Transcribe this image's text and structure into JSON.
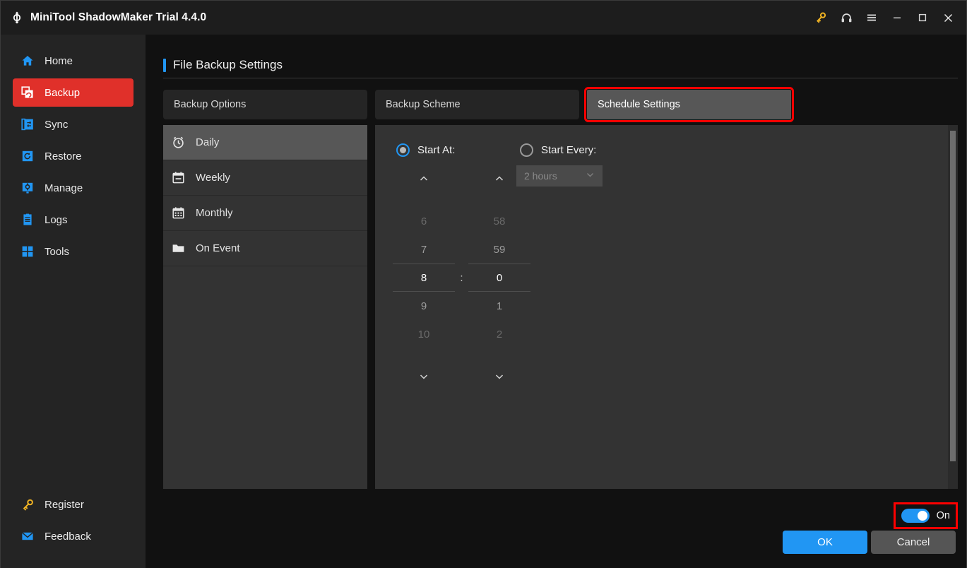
{
  "window": {
    "title": "MiniTool ShadowMaker Trial 4.4.0",
    "logo_icon": "shadowmaker-logo-icon",
    "controls": [
      {
        "name": "key-icon",
        "label": "⚷"
      },
      {
        "name": "headset-icon",
        "label": "☎"
      },
      {
        "name": "menu-icon",
        "label": "☰"
      },
      {
        "name": "minimize-icon",
        "label": "–"
      },
      {
        "name": "maximize-icon",
        "label": "□"
      },
      {
        "name": "close-icon",
        "label": "✕"
      }
    ]
  },
  "sidebar": {
    "items": [
      {
        "label": "Home",
        "icon": "home-icon",
        "active": false
      },
      {
        "label": "Backup",
        "icon": "backup-icon",
        "active": true
      },
      {
        "label": "Sync",
        "icon": "sync-icon",
        "active": false
      },
      {
        "label": "Restore",
        "icon": "restore-icon",
        "active": false
      },
      {
        "label": "Manage",
        "icon": "manage-icon",
        "active": false
      },
      {
        "label": "Logs",
        "icon": "logs-icon",
        "active": false
      },
      {
        "label": "Tools",
        "icon": "tools-icon",
        "active": false
      }
    ],
    "bottom_items": [
      {
        "label": "Register",
        "icon": "key-icon"
      },
      {
        "label": "Feedback",
        "icon": "envelope-icon"
      }
    ]
  },
  "page": {
    "title": "File Backup Settings",
    "accent_color": "#2196f3"
  },
  "tabs": [
    {
      "label": "Backup Options",
      "active": false,
      "annotated": false
    },
    {
      "label": "Backup Scheme",
      "active": false,
      "annotated": false
    },
    {
      "label": "Schedule Settings",
      "active": true,
      "annotated": true
    }
  ],
  "schedule_list": [
    {
      "label": "Daily",
      "icon": "alarm-clock-icon",
      "active": true
    },
    {
      "label": "Weekly",
      "icon": "calendar-icon",
      "active": false
    },
    {
      "label": "Monthly",
      "icon": "calendar-grid-icon",
      "active": false
    },
    {
      "label": "On Event",
      "icon": "folder-icon",
      "active": false
    }
  ],
  "schedule_detail": {
    "start_at": {
      "label": "Start At:",
      "selected": true
    },
    "start_every": {
      "label": "Start Every:",
      "selected": false
    },
    "every_select": {
      "value": "2 hours",
      "enabled": false,
      "chevron_icon": "chevron-down-icon"
    },
    "time_picker": {
      "separator": ":",
      "up_arrow_icon": "chevron-up-icon",
      "down_arrow_icon": "chevron-down-icon",
      "hours": {
        "above2": "6",
        "above1": "7",
        "selected": "8",
        "below1": "9",
        "below2": "10"
      },
      "minutes": {
        "above2": "58",
        "above1": "59",
        "selected": "0",
        "below1": "1",
        "below2": "2"
      }
    }
  },
  "footer": {
    "toggle": {
      "label": "On",
      "state": "on",
      "annotated": true
    },
    "ok_label": "OK",
    "cancel_label": "Cancel"
  },
  "colors": {
    "accent_blue": "#2196f3",
    "active_red": "#e0302a",
    "annotation_red": "#fe0000",
    "panel_bg": "#333333",
    "window_bg": "#111111",
    "sidebar_bg": "#242424",
    "key_gold": "#f0b323"
  }
}
